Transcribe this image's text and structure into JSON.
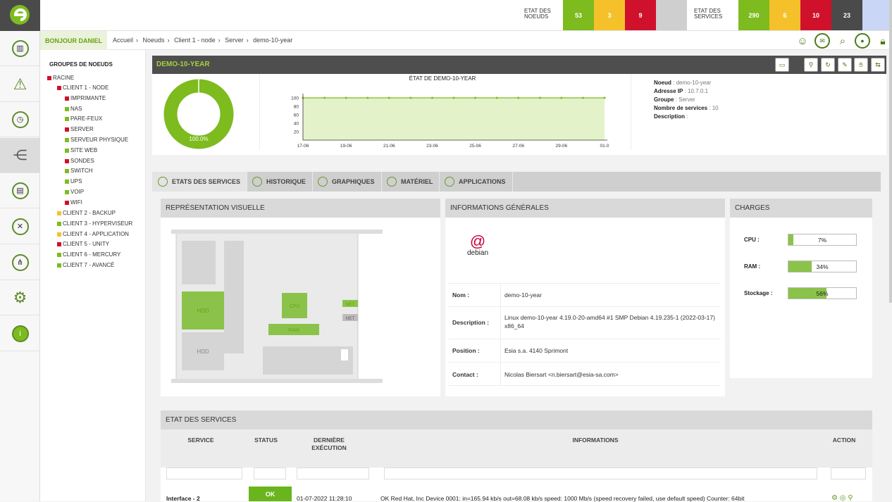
{
  "top": {
    "nodes_label_1": "ETAT DES",
    "nodes_label_2": "NOEUDS",
    "services_label_1": "ETAT DES",
    "services_label_2": "SERVICES",
    "node_counts": [
      "53",
      "3",
      "9",
      ""
    ],
    "service_counts": [
      "290",
      "6",
      "10",
      "23",
      ""
    ],
    "colors": {
      "green": "#7dbb1e",
      "yellow": "#f5c12b",
      "red": "#d0112b",
      "gray": "#cfcfcf",
      "dark": "#4a4a4a",
      "blue": "#c9d6f5"
    }
  },
  "header": {
    "greeting": "BONJOUR DANIEL",
    "breadcrumb": [
      "Accueil",
      "Noeuds",
      "Client 1 - node",
      "Server",
      "demo-10-year"
    ]
  },
  "tree": {
    "title": "GROUPES DE NOEUDS",
    "root": "RACINE",
    "items": [
      {
        "label": "CLIENT 1 - NODE",
        "color": "#d0112b"
      },
      {
        "label": "IMPRIMANTE",
        "color": "#d0112b"
      },
      {
        "label": "NAS",
        "color": "#7dbb1e"
      },
      {
        "label": "PARE-FEUX",
        "color": "#7dbb1e"
      },
      {
        "label": "SERVER",
        "color": "#d0112b"
      },
      {
        "label": "SERVEUR PHYSIQUE",
        "color": "#7dbb1e"
      },
      {
        "label": "SITE WEB",
        "color": "#7dbb1e"
      },
      {
        "label": "SONDES",
        "color": "#d0112b"
      },
      {
        "label": "SWITCH",
        "color": "#7dbb1e"
      },
      {
        "label": "UPS",
        "color": "#7dbb1e"
      },
      {
        "label": "VOIP",
        "color": "#7dbb1e"
      },
      {
        "label": "WIFI",
        "color": "#d0112b"
      },
      {
        "label": "CLIENT 2 - BACKUP",
        "color": "#f5c12b"
      },
      {
        "label": "CLIENT 3 - HYPERVISEUR",
        "color": "#7dbb1e"
      },
      {
        "label": "CLIENT 4 - APPLICATION",
        "color": "#f5c12b"
      },
      {
        "label": "CLIENT 5 - UNITY",
        "color": "#d0112b"
      },
      {
        "label": "CLIENT 6 - MERCURY",
        "color": "#7dbb1e"
      },
      {
        "label": "CLIENT 7 - AVANCÉ",
        "color": "#7dbb1e"
      }
    ]
  },
  "node": {
    "title": "DEMO-10-YEAR",
    "donut_label": "100.0%",
    "donut_fraction": 1.0,
    "info": {
      "noeud_k": "Noeud",
      "noeud_v": "demo-10-year",
      "ip_k": "Adresse IP",
      "ip_v": "10.7.0.1",
      "groupe_k": "Groupe",
      "groupe_v": "Server",
      "nb_k": "Nombre de services",
      "nb_v": "10",
      "desc_k": "Description",
      "desc_v": ""
    }
  },
  "chart_data": {
    "type": "area",
    "title": "ÉTAT DE DEMO-10-YEAR",
    "x": [
      "17-06",
      "19-06",
      "21-06",
      "23-06",
      "25-06",
      "27-06",
      "29-06",
      "01-0"
    ],
    "y_ticks": [
      20,
      40,
      60,
      80,
      100
    ],
    "ylim": [
      0,
      100
    ],
    "series": [
      {
        "values": [
          100,
          100,
          100,
          100,
          100,
          100,
          100,
          100,
          100,
          100,
          100,
          100,
          100,
          100,
          100
        ]
      }
    ]
  },
  "tabs": [
    "ETATS DES SERVICES",
    "HISTORIQUE",
    "GRAPHIQUES",
    "MATÉRIEL",
    "APPLICATIONS"
  ],
  "visual": {
    "title": "REPRÉSENTATION VISUELLE",
    "hdd1": "HDD",
    "hdd2": "HDD",
    "cpu": "CPU",
    "ram": "RAM",
    "net1": "NET",
    "net2": "NET"
  },
  "general": {
    "title": "INFORMATIONS GÉNÉRALES",
    "logo_text": "debian",
    "rows": [
      {
        "k": "Nom :",
        "v": "demo-10-year"
      },
      {
        "k": "Description :",
        "v": "Linux demo-10-year 4.19.0-20-amd64 #1 SMP Debian 4.19.235-1 (2022-03-17) x86_64"
      },
      {
        "k": "Position :",
        "v": "Esia s.a. 4140 Sprimont"
      },
      {
        "k": "Contact :",
        "v": "Nicolas Biersart <n.biersart@esia-sa.com>"
      }
    ]
  },
  "charges": {
    "title": "CHARGES",
    "items": [
      {
        "label": "CPU :",
        "text": "7%",
        "fraction": 0.07
      },
      {
        "label": "RAM :",
        "text": "34%",
        "fraction": 0.34
      },
      {
        "label": "Stockage :",
        "text": "56%",
        "fraction": 0.56
      }
    ]
  },
  "services": {
    "title": "ETAT DES SERVICES",
    "cols": [
      "SERVICE",
      "STATUS",
      "DERNIÈRE EXÉCUTION",
      "INFORMATIONS",
      "ACTION"
    ],
    "row": {
      "service": "Interface - 2",
      "status": "OK",
      "last": "01-07-2022 11:28:10",
      "info": "OK Red Hat, Inc Device 0001: in=165.94 kb/s out=68.08 kb/s speed: 1000 Mb/s (speed recovery failed, use default speed) Counter: 64bit"
    }
  }
}
